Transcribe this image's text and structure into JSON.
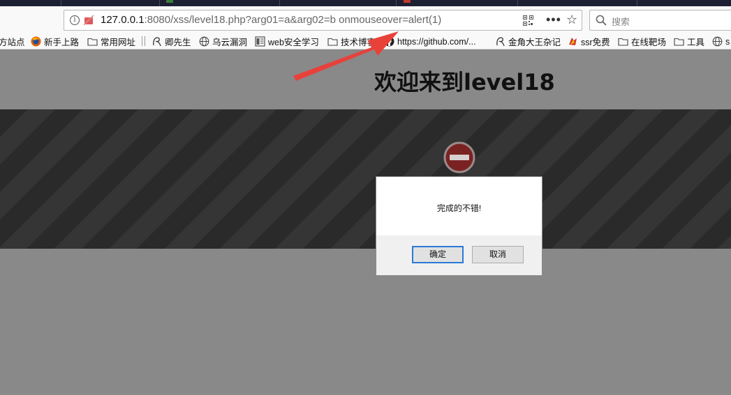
{
  "browser": {
    "url_host": "127.0.0.1",
    "url_rest": ":8080/xss/level18.php?arg01=a&arg02=b onmouseover=alert(1)",
    "search_placeholder": "搜索"
  },
  "bookmarks": [
    {
      "label": "方站点",
      "icon": "none"
    },
    {
      "label": "新手上路",
      "icon": "firefox-icon"
    },
    {
      "label": "常用网址",
      "icon": "folder-icon"
    },
    {
      "label": "卿先生",
      "icon": "swirl-icon"
    },
    {
      "label": "乌云漏洞",
      "icon": "globe-icon"
    },
    {
      "label": "web安全学习",
      "icon": "page-icon"
    },
    {
      "label": "技术博客",
      "icon": "folder-icon"
    },
    {
      "label": "https://github.com/...",
      "icon": "github-icon"
    },
    {
      "label": "金角大王杂记",
      "icon": "swirl-icon"
    },
    {
      "label": "ssr免费",
      "icon": "ssr-icon"
    },
    {
      "label": "在线靶场",
      "icon": "folder-icon"
    },
    {
      "label": "工具",
      "icon": "folder-icon"
    },
    {
      "label": "s",
      "icon": "globe-icon"
    }
  ],
  "page": {
    "title": "欢迎来到level18"
  },
  "dialog": {
    "message": "完成的不错!",
    "ok_label": "确定",
    "cancel_label": "取消"
  },
  "colors": {
    "annotation_arrow": "#e8413a",
    "ok_button_border": "#2a7ad6",
    "page_background": "#898989"
  }
}
